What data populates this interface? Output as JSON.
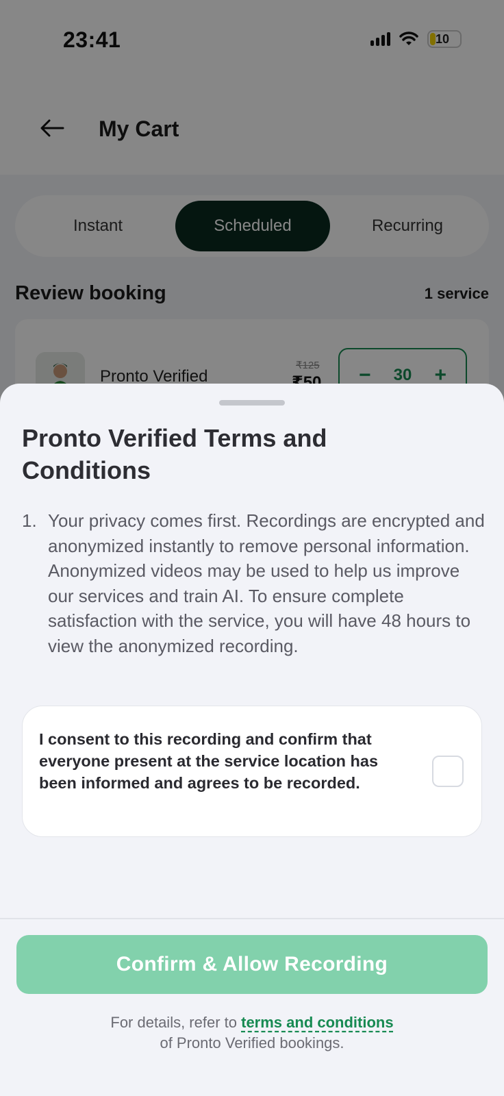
{
  "status_bar": {
    "time": "23:41",
    "battery": "10"
  },
  "header": {
    "title": "My Cart",
    "back_icon": "arrow-left-icon"
  },
  "tabs": [
    {
      "label": "Instant",
      "selected": false
    },
    {
      "label": "Scheduled",
      "selected": true
    },
    {
      "label": "Recurring",
      "selected": false
    }
  ],
  "review": {
    "title": "Review booking",
    "count": "1 service"
  },
  "service": {
    "name": "Pronto Verified",
    "price_old": "₹125",
    "price_new": "₹50",
    "quantity": "30",
    "minus": "−",
    "plus": "+"
  },
  "sheet": {
    "title": "Pronto Verified Terms and Conditions",
    "terms": [
      {
        "number": "1.",
        "text": "Your privacy comes first. Recordings are encrypted and anonymized instantly to remove personal information. Anonymized videos may be used to help us improve our services and train AI. To ensure complete satisfaction with the service, you will have 48 hours to view the anonymized recording."
      }
    ],
    "consent_text": "I consent to this recording and confirm that everyone present at the service location has been informed and agrees to be recorded.",
    "consent_checked": false,
    "confirm_label": "Confirm & Allow Recording",
    "footer_prefix": "For details, refer to ",
    "footer_link": "terms and conditions",
    "footer_suffix": "of Pronto Verified bookings."
  },
  "colors": {
    "accent": "#178a52",
    "confirm_button": "#82d1ac",
    "selected_tab": "#0a2a1f",
    "sheet_background": "#f2f3f8"
  }
}
